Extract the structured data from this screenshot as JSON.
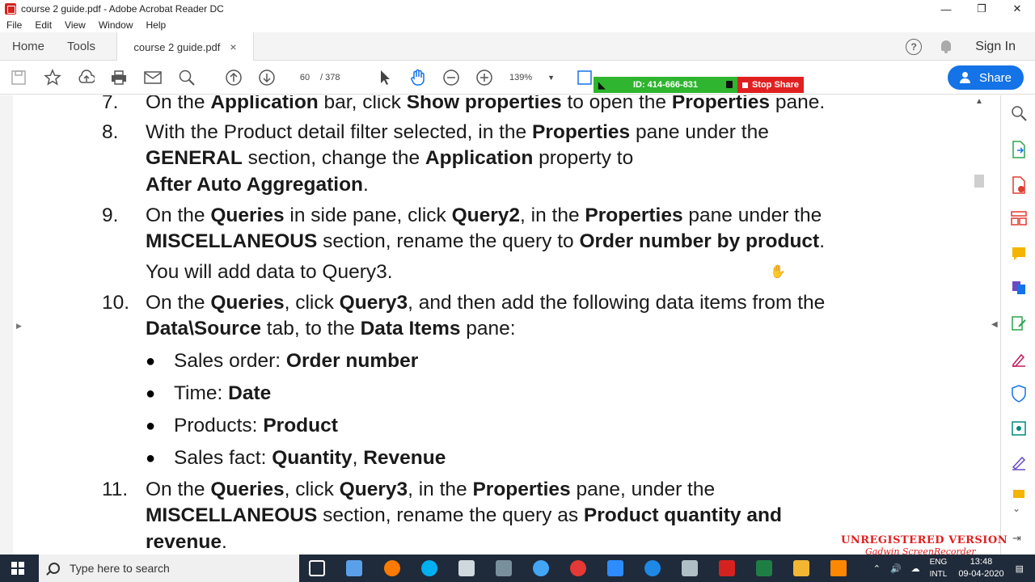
{
  "window": {
    "title": "course 2 guide.pdf - Adobe Acrobat Reader DC",
    "minimize": "—",
    "restore": "❐",
    "close": "✕"
  },
  "menu": [
    "File",
    "Edit",
    "View",
    "Window",
    "Help"
  ],
  "tabs": {
    "home": "Home",
    "tools": "Tools",
    "document": "course 2 guide.pdf",
    "close": "×",
    "help": "?",
    "signin": "Sign In"
  },
  "toolbar": {
    "page_current": "60",
    "page_total": "/  378",
    "zoom": "139%",
    "share": "Share"
  },
  "banner": {
    "id": "ID: 414-666-831",
    "stop": "Stop Share"
  },
  "document": {
    "n7": "7.",
    "n8": "8.",
    "n9": "9.",
    "n10": "10.",
    "n11": "11.",
    "l7": [
      "On the ",
      "Application",
      " bar, click ",
      "Show properties",
      " to open the ",
      "Properties",
      " pane."
    ],
    "l8a": [
      "With the Product detail filter selected, in the ",
      "Properties",
      " pane under the"
    ],
    "l8b": [
      "GENERAL",
      " section, change the ",
      "Application",
      " property to"
    ],
    "l8c": [
      "After Auto Aggregation",
      "."
    ],
    "l9a": [
      "On the ",
      "Queries",
      " in side pane, click ",
      "Query2",
      ", in the ",
      "Properties",
      " pane under the"
    ],
    "l9b": [
      "MISCELLANEOUS",
      " section, rename the query to ",
      "Order number by product",
      "."
    ],
    "l9c": "You will add data to Query3.",
    "l10a": [
      "On the ",
      "Queries",
      ", click ",
      "Query3",
      ", and then add the following data items from the"
    ],
    "l10b": [
      "Data\\Source",
      " tab, to the ",
      "Data Items",
      " pane:"
    ],
    "bullets": [
      [
        "Sales order: ",
        "Order number"
      ],
      [
        "Time: ",
        "Date"
      ],
      [
        "Products: ",
        "Product"
      ],
      [
        "Sales fact: ",
        "Quantity",
        ", ",
        "Revenue"
      ]
    ],
    "l11a": [
      "On the ",
      "Queries",
      ", click ",
      "Query3",
      ", in the ",
      "Properties",
      " pane, under the"
    ],
    "l11b": [
      "MISCELLANEOUS",
      " section, rename the query as ",
      "Product quantity and"
    ],
    "l11c": [
      "revenue",
      "."
    ]
  },
  "watermark": {
    "line1": "UNREGISTERED VERSION",
    "line2": "Gadwin ScreenRecorder"
  },
  "taskbar": {
    "search_placeholder": "Type here to search",
    "lang1": "ENG",
    "lang2": "INTL",
    "time": "13:48",
    "date": "09-04-2020"
  }
}
